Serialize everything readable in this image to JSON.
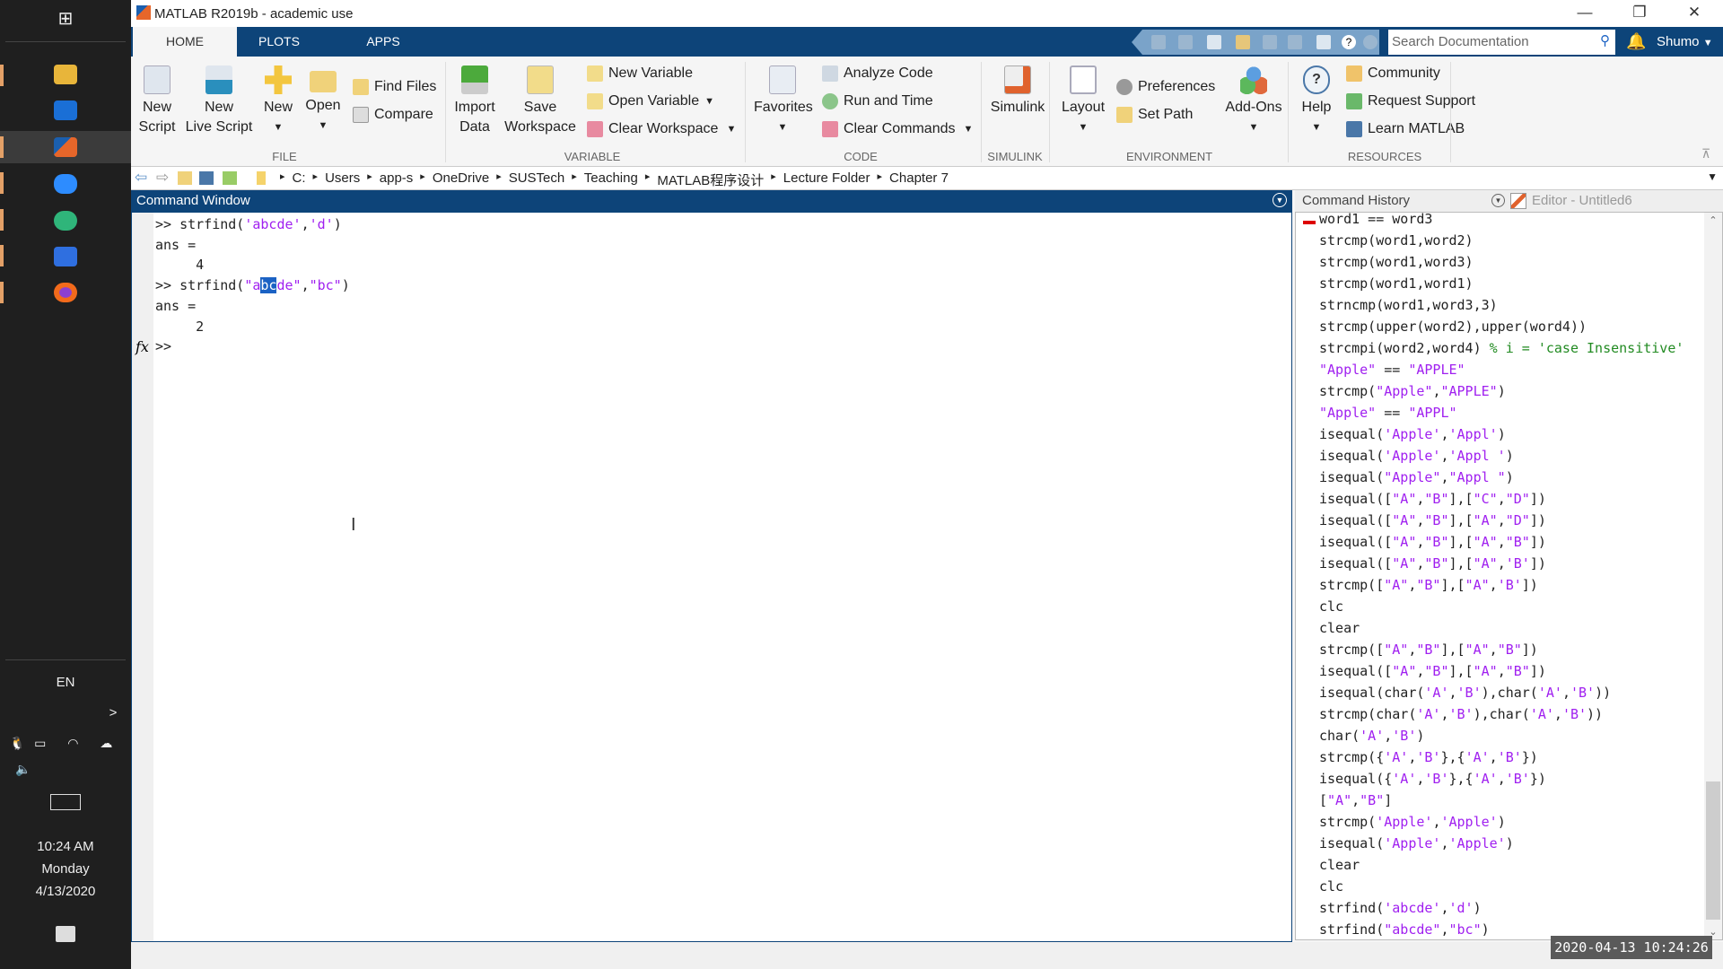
{
  "taskbar": {
    "apps": [
      "windows-start",
      "file-explorer",
      "store",
      "matlab",
      "zoom",
      "chat",
      "wps",
      "firefox"
    ],
    "language": "EN",
    "time": "10:24 AM",
    "day": "Monday",
    "date": "4/13/2020"
  },
  "window": {
    "title": "MATLAB R2019b - academic use"
  },
  "tabs": [
    "HOME",
    "PLOTS",
    "APPS"
  ],
  "search": {
    "placeholder": "Search Documentation"
  },
  "user": "Shumo",
  "ribbon": {
    "new_script": [
      "New",
      "Script"
    ],
    "new_live_script": [
      "New",
      "Live Script"
    ],
    "new": "New",
    "open": "Open",
    "find_files": "Find Files",
    "compare": "Compare",
    "import_data": [
      "Import",
      "Data"
    ],
    "save_workspace": [
      "Save",
      "Workspace"
    ],
    "new_variable": "New Variable",
    "open_variable": "Open Variable",
    "clear_workspace": "Clear Workspace",
    "favorites": "Favorites",
    "analyze_code": "Analyze Code",
    "run_and_time": "Run and Time",
    "clear_commands": "Clear Commands",
    "simulink": "Simulink",
    "layout": "Layout",
    "preferences": "Preferences",
    "set_path": "Set Path",
    "add_ons": "Add-Ons",
    "help": "Help",
    "community": "Community",
    "request_support": "Request Support",
    "learn_matlab": "Learn MATLAB",
    "sections": [
      "FILE",
      "VARIABLE",
      "CODE",
      "SIMULINK",
      "ENVIRONMENT",
      "RESOURCES"
    ]
  },
  "path": [
    "C:",
    "Users",
    "app-s",
    "OneDrive",
    "SUSTech",
    "Teaching",
    "MATLAB程序设计",
    "Lecture Folder",
    "Chapter 7"
  ],
  "command_window": {
    "title": "Command Window",
    "lines": [
      [
        {
          "t": ">> strfind(",
          "c": ""
        },
        {
          "t": "'abcde'",
          "c": "s"
        },
        {
          "t": ",",
          "c": ""
        },
        {
          "t": "'d'",
          "c": "s"
        },
        {
          "t": ")",
          "c": ""
        }
      ],
      [
        {
          "t": "ans =",
          "c": ""
        }
      ],
      [
        {
          "t": "     4",
          "c": ""
        }
      ],
      [
        {
          "t": ">> strfind(",
          "c": ""
        },
        {
          "t": "\"a",
          "c": "s"
        },
        {
          "t": "bc",
          "c": "sel"
        },
        {
          "t": "de\"",
          "c": "s"
        },
        {
          "t": ",",
          "c": ""
        },
        {
          "t": "\"bc\"",
          "c": "s"
        },
        {
          "t": ")",
          "c": ""
        }
      ],
      [
        {
          "t": "ans =",
          "c": ""
        }
      ],
      [
        {
          "t": "     2",
          "c": ""
        }
      ],
      [
        {
          "t": ">>",
          "c": ""
        }
      ]
    ]
  },
  "history": {
    "title": "Command History",
    "editor_tab": "Editor - Untitled6",
    "lines": [
      [
        {
          "t": "word1 == word3",
          "c": ""
        }
      ],
      [
        {
          "t": "strcmp(word1,word2)",
          "c": ""
        }
      ],
      [
        {
          "t": "strcmp(word1,word3)",
          "c": ""
        }
      ],
      [
        {
          "t": "strcmp(word1,word1)",
          "c": ""
        }
      ],
      [
        {
          "t": "strncmp(word1,word3,3)",
          "c": ""
        }
      ],
      [
        {
          "t": "strcmp(upper(word2),upper(word4))",
          "c": ""
        }
      ],
      [
        {
          "t": "strcmpi(word2,word4) ",
          "c": ""
        },
        {
          "t": "% i = 'case Insensitive'",
          "c": "c"
        }
      ],
      [
        {
          "t": "\"Apple\"",
          "c": "s"
        },
        {
          "t": " == ",
          "c": ""
        },
        {
          "t": "\"APPLE\"",
          "c": "s"
        }
      ],
      [
        {
          "t": "strcmp(",
          "c": ""
        },
        {
          "t": "\"Apple\"",
          "c": "s"
        },
        {
          "t": ",",
          "c": ""
        },
        {
          "t": "\"APPLE\"",
          "c": "s"
        },
        {
          "t": ")",
          "c": ""
        }
      ],
      [
        {
          "t": "\"Apple\"",
          "c": "s"
        },
        {
          "t": " == ",
          "c": ""
        },
        {
          "t": "\"APPL\"",
          "c": "s"
        }
      ],
      [
        {
          "t": "isequal(",
          "c": ""
        },
        {
          "t": "'Apple'",
          "c": "s"
        },
        {
          "t": ",",
          "c": ""
        },
        {
          "t": "'Appl'",
          "c": "s"
        },
        {
          "t": ")",
          "c": ""
        }
      ],
      [
        {
          "t": "isequal(",
          "c": ""
        },
        {
          "t": "'Apple'",
          "c": "s"
        },
        {
          "t": ",",
          "c": ""
        },
        {
          "t": "'Appl '",
          "c": "s"
        },
        {
          "t": ")",
          "c": ""
        }
      ],
      [
        {
          "t": "isequal(",
          "c": ""
        },
        {
          "t": "\"Apple\"",
          "c": "s"
        },
        {
          "t": ",",
          "c": ""
        },
        {
          "t": "\"Appl \"",
          "c": "s"
        },
        {
          "t": ")",
          "c": ""
        }
      ],
      [
        {
          "t": "isequal([",
          "c": ""
        },
        {
          "t": "\"A\"",
          "c": "s"
        },
        {
          "t": ",",
          "c": ""
        },
        {
          "t": "\"B\"",
          "c": "s"
        },
        {
          "t": "],[",
          "c": ""
        },
        {
          "t": "\"C\"",
          "c": "s"
        },
        {
          "t": ",",
          "c": ""
        },
        {
          "t": "\"D\"",
          "c": "s"
        },
        {
          "t": "])",
          "c": ""
        }
      ],
      [
        {
          "t": "isequal([",
          "c": ""
        },
        {
          "t": "\"A\"",
          "c": "s"
        },
        {
          "t": ",",
          "c": ""
        },
        {
          "t": "\"B\"",
          "c": "s"
        },
        {
          "t": "],[",
          "c": ""
        },
        {
          "t": "\"A\"",
          "c": "s"
        },
        {
          "t": ",",
          "c": ""
        },
        {
          "t": "\"D\"",
          "c": "s"
        },
        {
          "t": "])",
          "c": ""
        }
      ],
      [
        {
          "t": "isequal([",
          "c": ""
        },
        {
          "t": "\"A\"",
          "c": "s"
        },
        {
          "t": ",",
          "c": ""
        },
        {
          "t": "\"B\"",
          "c": "s"
        },
        {
          "t": "],[",
          "c": ""
        },
        {
          "t": "\"A\"",
          "c": "s"
        },
        {
          "t": ",",
          "c": ""
        },
        {
          "t": "\"B\"",
          "c": "s"
        },
        {
          "t": "])",
          "c": ""
        }
      ],
      [
        {
          "t": "isequal([",
          "c": ""
        },
        {
          "t": "\"A\"",
          "c": "s"
        },
        {
          "t": ",",
          "c": ""
        },
        {
          "t": "\"B\"",
          "c": "s"
        },
        {
          "t": "],[",
          "c": ""
        },
        {
          "t": "\"A\"",
          "c": "s"
        },
        {
          "t": ",",
          "c": ""
        },
        {
          "t": "'B'",
          "c": "s"
        },
        {
          "t": "])",
          "c": ""
        }
      ],
      [
        {
          "t": "strcmp([",
          "c": ""
        },
        {
          "t": "\"A\"",
          "c": "s"
        },
        {
          "t": ",",
          "c": ""
        },
        {
          "t": "\"B\"",
          "c": "s"
        },
        {
          "t": "],[",
          "c": ""
        },
        {
          "t": "\"A\"",
          "c": "s"
        },
        {
          "t": ",",
          "c": ""
        },
        {
          "t": "'B'",
          "c": "s"
        },
        {
          "t": "])",
          "c": ""
        }
      ],
      [
        {
          "t": "clc",
          "c": ""
        }
      ],
      [
        {
          "t": "clear",
          "c": ""
        }
      ],
      [
        {
          "t": "strcmp([",
          "c": ""
        },
        {
          "t": "\"A\"",
          "c": "s"
        },
        {
          "t": ",",
          "c": ""
        },
        {
          "t": "\"B\"",
          "c": "s"
        },
        {
          "t": "],[",
          "c": ""
        },
        {
          "t": "\"A\"",
          "c": "s"
        },
        {
          "t": ",",
          "c": ""
        },
        {
          "t": "\"B\"",
          "c": "s"
        },
        {
          "t": "])",
          "c": ""
        }
      ],
      [
        {
          "t": "isequal([",
          "c": ""
        },
        {
          "t": "\"A\"",
          "c": "s"
        },
        {
          "t": ",",
          "c": ""
        },
        {
          "t": "\"B\"",
          "c": "s"
        },
        {
          "t": "],[",
          "c": ""
        },
        {
          "t": "\"A\"",
          "c": "s"
        },
        {
          "t": ",",
          "c": ""
        },
        {
          "t": "\"B\"",
          "c": "s"
        },
        {
          "t": "])",
          "c": ""
        }
      ],
      [
        {
          "t": "isequal(char(",
          "c": ""
        },
        {
          "t": "'A'",
          "c": "s"
        },
        {
          "t": ",",
          "c": ""
        },
        {
          "t": "'B'",
          "c": "s"
        },
        {
          "t": "),char(",
          "c": ""
        },
        {
          "t": "'A'",
          "c": "s"
        },
        {
          "t": ",",
          "c": ""
        },
        {
          "t": "'B'",
          "c": "s"
        },
        {
          "t": "))",
          "c": ""
        }
      ],
      [
        {
          "t": "strcmp(char(",
          "c": ""
        },
        {
          "t": "'A'",
          "c": "s"
        },
        {
          "t": ",",
          "c": ""
        },
        {
          "t": "'B'",
          "c": "s"
        },
        {
          "t": "),char(",
          "c": ""
        },
        {
          "t": "'A'",
          "c": "s"
        },
        {
          "t": ",",
          "c": ""
        },
        {
          "t": "'B'",
          "c": "s"
        },
        {
          "t": "))",
          "c": ""
        }
      ],
      [
        {
          "t": "char(",
          "c": ""
        },
        {
          "t": "'A'",
          "c": "s"
        },
        {
          "t": ",",
          "c": ""
        },
        {
          "t": "'B'",
          "c": "s"
        },
        {
          "t": ")",
          "c": ""
        }
      ],
      [
        {
          "t": "strcmp({",
          "c": ""
        },
        {
          "t": "'A'",
          "c": "s"
        },
        {
          "t": ",",
          "c": ""
        },
        {
          "t": "'B'",
          "c": "s"
        },
        {
          "t": "},{",
          "c": ""
        },
        {
          "t": "'A'",
          "c": "s"
        },
        {
          "t": ",",
          "c": ""
        },
        {
          "t": "'B'",
          "c": "s"
        },
        {
          "t": "})",
          "c": ""
        }
      ],
      [
        {
          "t": "isequal({",
          "c": ""
        },
        {
          "t": "'A'",
          "c": "s"
        },
        {
          "t": ",",
          "c": ""
        },
        {
          "t": "'B'",
          "c": "s"
        },
        {
          "t": "},{",
          "c": ""
        },
        {
          "t": "'A'",
          "c": "s"
        },
        {
          "t": ",",
          "c": ""
        },
        {
          "t": "'B'",
          "c": "s"
        },
        {
          "t": "})",
          "c": ""
        }
      ],
      [
        {
          "t": "[",
          "c": ""
        },
        {
          "t": "\"A\"",
          "c": "s"
        },
        {
          "t": ",",
          "c": ""
        },
        {
          "t": "\"B\"",
          "c": "s"
        },
        {
          "t": "]",
          "c": ""
        }
      ],
      [
        {
          "t": "strcmp(",
          "c": ""
        },
        {
          "t": "'Apple'",
          "c": "s"
        },
        {
          "t": ",",
          "c": ""
        },
        {
          "t": "'Apple'",
          "c": "s"
        },
        {
          "t": ")",
          "c": ""
        }
      ],
      [
        {
          "t": "isequal(",
          "c": ""
        },
        {
          "t": "'Apple'",
          "c": "s"
        },
        {
          "t": ",",
          "c": ""
        },
        {
          "t": "'Apple'",
          "c": "s"
        },
        {
          "t": ")",
          "c": ""
        }
      ],
      [
        {
          "t": "clear",
          "c": ""
        }
      ],
      [
        {
          "t": "clc",
          "c": ""
        }
      ],
      [
        {
          "t": "strfind(",
          "c": ""
        },
        {
          "t": "'abcde'",
          "c": "s"
        },
        {
          "t": ",",
          "c": ""
        },
        {
          "t": "'d'",
          "c": "s"
        },
        {
          "t": ")",
          "c": ""
        }
      ],
      [
        {
          "t": "strfind(",
          "c": ""
        },
        {
          "t": "\"abcde\"",
          "c": "s"
        },
        {
          "t": ",",
          "c": ""
        },
        {
          "t": "\"bc\"",
          "c": "s"
        },
        {
          "t": ")",
          "c": ""
        }
      ]
    ]
  },
  "recording_timestamp": "2020-04-13 10:24:26",
  "colors": {
    "string": "#a020f0",
    "comment": "#228b22",
    "header": "#0d4479",
    "selection": "#1b62c4"
  }
}
